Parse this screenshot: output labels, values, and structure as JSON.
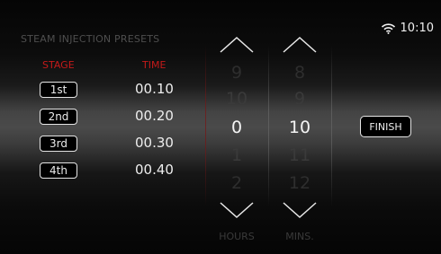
{
  "title": "STEAM INJECTION PRESETS",
  "status": {
    "time": "10:10",
    "wifi_icon": "wifi-icon"
  },
  "table": {
    "stage_header": "STAGE",
    "time_header": "TIME",
    "rows": [
      {
        "stage": "1st",
        "time": "00.10"
      },
      {
        "stage": "2nd",
        "time": "00.20"
      },
      {
        "stage": "3rd",
        "time": "00.30"
      },
      {
        "stage": "4th",
        "time": "00.40"
      }
    ]
  },
  "hours_wheel": {
    "values": [
      "9",
      "10",
      "0",
      "1",
      "2"
    ],
    "selected": "0",
    "label": "HOURS"
  },
  "mins_wheel": {
    "values": [
      "8",
      "9",
      "10",
      "11",
      "12"
    ],
    "selected": "10",
    "label": "MINS."
  },
  "finish_label": "FINISH",
  "colors": {
    "accent_red": "#c41a1a",
    "text_primary": "#f0f0f0",
    "text_dim": "#3a3a3a"
  }
}
